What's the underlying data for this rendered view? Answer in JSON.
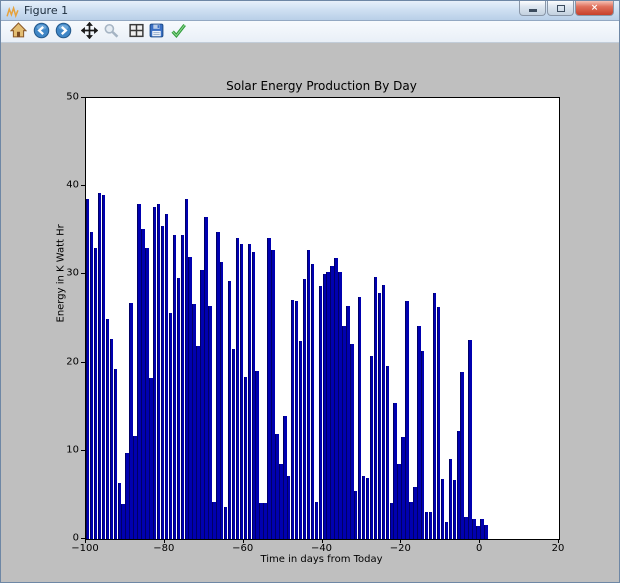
{
  "window": {
    "title": "Figure 1",
    "controls": {
      "minimize": "minimize",
      "maximize": "maximize",
      "close": "×"
    }
  },
  "toolbar": {
    "icons": [
      {
        "name": "home-icon",
        "action": "Home"
      },
      {
        "name": "back-icon",
        "action": "Back"
      },
      {
        "name": "forward-icon",
        "action": "Forward"
      },
      {
        "name": "pan-icon",
        "action": "Pan"
      },
      {
        "name": "zoom-rect-icon",
        "action": "Zoom"
      },
      {
        "name": "configure-subplots-icon",
        "action": "Configure subplots"
      },
      {
        "name": "save-icon",
        "action": "Save"
      },
      {
        "name": "customize-check-icon",
        "action": "Customize"
      }
    ]
  },
  "colors": {
    "bar": "#0000b0",
    "bar_edge": "#000066",
    "figure_bg": "#bfbfbf",
    "axes_bg": "#ffffff",
    "titlebar": "#cfe0f2",
    "close_button": "#c6402b"
  },
  "chart_data": {
    "type": "bar",
    "title": "Solar Energy Production By Day",
    "xlabel": "Time in days from Today",
    "ylabel": "Energy in K Watt Hr",
    "xlim": [
      -100,
      20
    ],
    "ylim": [
      0,
      50
    ],
    "xticks": [
      -100,
      -80,
      -60,
      -40,
      -20,
      0,
      20
    ],
    "yticks": [
      0,
      10,
      20,
      30,
      40,
      50
    ],
    "grid": false,
    "legend": "none",
    "x_start_day": -100,
    "x_step": 1,
    "values": [
      38.5,
      34.8,
      33.0,
      39.2,
      39.0,
      24.9,
      22.7,
      19.3,
      6.4,
      4.0,
      9.8,
      26.8,
      11.7,
      38.0,
      35.2,
      33.0,
      18.2,
      37.6,
      38.0,
      35.5,
      36.9,
      25.6,
      34.5,
      29.6,
      34.5,
      38.5,
      32.0,
      26.6,
      21.9,
      30.5,
      36.5,
      26.4,
      4.2,
      34.8,
      31.4,
      3.6,
      29.2,
      21.6,
      34.1,
      33.4,
      18.4,
      33.4,
      32.5,
      19.0,
      4.1,
      4.1,
      34.1,
      32.8,
      11.9,
      8.5,
      14.0,
      7.2,
      27.1,
      27.0,
      22.4,
      29.5,
      32.8,
      31.2,
      4.2,
      28.7,
      30.0,
      30.3,
      31.0,
      31.9,
      30.3,
      24.2,
      26.4,
      22.1,
      5.5,
      27.4,
      7.1,
      6.9,
      20.8,
      29.7,
      27.9,
      28.8,
      19.6,
      4.1,
      15.4,
      8.5,
      11.6,
      27.0,
      4.2,
      5.9,
      24.2,
      21.3,
      3.1,
      3.1,
      27.9,
      26.3,
      6.8,
      1.9,
      9.1,
      6.7,
      12.3,
      18.9,
      2.5,
      22.6,
      2.3,
      1.5,
      2.3,
      1.6
    ]
  }
}
